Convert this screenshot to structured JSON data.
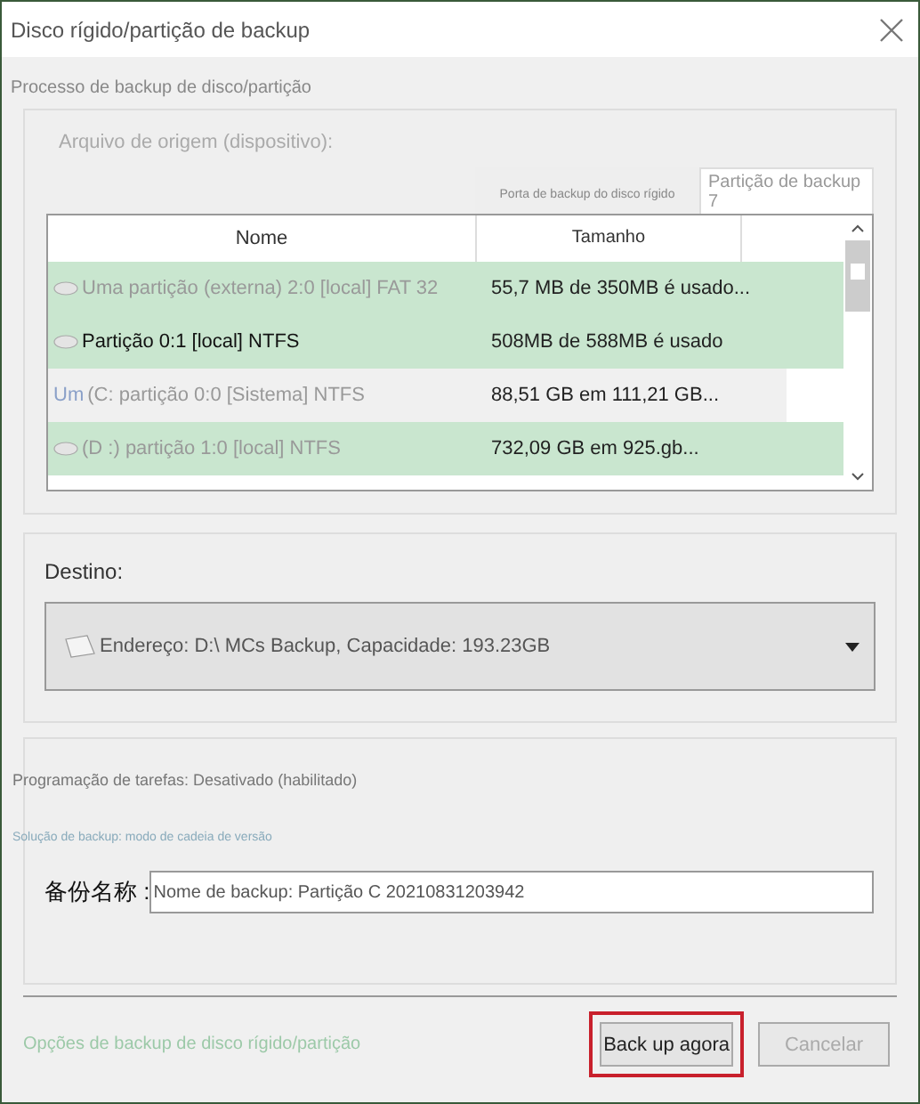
{
  "window": {
    "title": "Disco rígido/partição de backup"
  },
  "process_label": "Processo de backup de disco/partição",
  "source": {
    "label": "Arquivo de origem (dispositivo):",
    "tabs": [
      {
        "label": "Porta de backup do disco rígido",
        "selected": false
      },
      {
        "label": "Partição de backup 7",
        "selected": true
      }
    ],
    "table": {
      "columns": [
        "Nome",
        "Tamanho"
      ],
      "rows": [
        {
          "kind": "disk",
          "name": "Uma partição (externa) 2:0 [local] FAT 32",
          "size": "55,7 MB de 350MB é usado...",
          "selected": true
        },
        {
          "kind": "disk",
          "name": "Partição 0:1 [local] NTFS",
          "size": "508MB de 588MB é usado",
          "selected": true
        },
        {
          "kind": "prefix",
          "prefix": "Um",
          "name": "(C: partição 0:0 [Sistema] NTFS",
          "size": "88,51 GB em 111,21 GB...",
          "selected": false
        },
        {
          "kind": "disk",
          "name": "(D :) partição 1:0 [local] NTFS",
          "size": "732,09 GB em 925.gb...",
          "selected": true
        }
      ]
    }
  },
  "destination": {
    "label": "Destino:",
    "value": "Endereço: D:\\ MCs Backup, Capacidade: 193.23GB"
  },
  "schedule": "Programação de tarefas: Desativado (habilitado)",
  "scheme": "Solução de backup: modo de cadeia de versão",
  "backup_name": {
    "label": "备份名称 :",
    "value": "Nome de backup: Partição C 20210831203942"
  },
  "options_link": "Opções de backup de disco rígido/partição",
  "buttons": [
    {
      "label": "Back up agora",
      "highlighted": true,
      "disabled": false
    },
    {
      "label": "Cancelar",
      "highlighted": false,
      "disabled": true
    }
  ]
}
